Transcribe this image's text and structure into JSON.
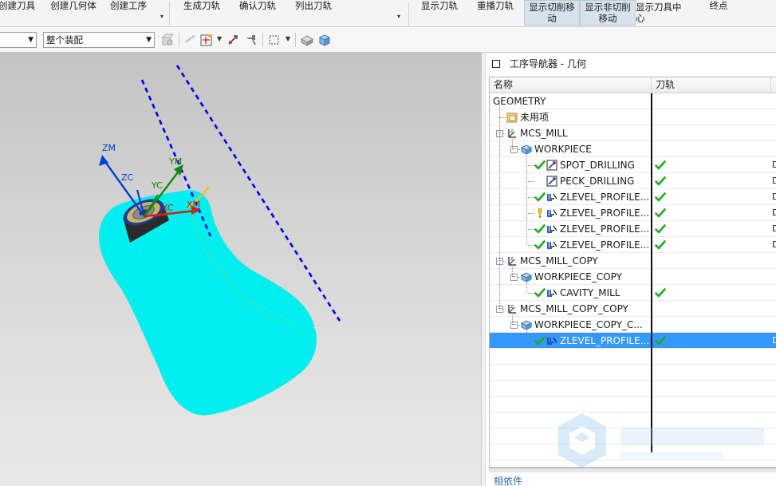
{
  "ribbon": {
    "buttons": [
      {
        "id": "create-tool",
        "label": "创建刀具"
      },
      {
        "id": "create-geometry",
        "label": "创建几何体"
      },
      {
        "id": "create-operation",
        "label": "创建工序"
      },
      {
        "id": "generate-path",
        "label": "生成刀轨"
      },
      {
        "id": "verify-path",
        "label": "确认刀轨"
      },
      {
        "id": "list-path",
        "label": "列出刀轨"
      },
      {
        "id": "show-path",
        "label": "显示刀轨"
      },
      {
        "id": "replay-path",
        "label": "重播刀轨"
      },
      {
        "id": "show-cut-moves",
        "label": "显示切削移动",
        "line1": "显示切削移",
        "line2": "动",
        "active": true
      },
      {
        "id": "show-noncut-moves",
        "label": "显示非切削移动",
        "line1": "显示非切削",
        "line2": "移动",
        "active": true
      },
      {
        "id": "show-tool-center",
        "label": "显示刀具中心",
        "line1": "显示刀具中",
        "line2": "心"
      },
      {
        "id": "end-point",
        "label": "终点"
      }
    ]
  },
  "toolbar": {
    "filter_combo": "",
    "assembly_combo": "整个装配"
  },
  "viewport": {
    "axes": {
      "zm": "ZM",
      "zc": "ZC",
      "ym": "YM",
      "yc": "YC",
      "xc": "XC",
      "xm": "XM"
    },
    "colors": {
      "part": "#00eeee",
      "toolpath": "#0000ee",
      "background": "#d0d0d0"
    }
  },
  "navigator": {
    "title": "工序导航器 - 几何",
    "columns": [
      "名称",
      "刀轨",
      ""
    ],
    "rows": [
      {
        "name": "GEOMETRY",
        "level": 0,
        "icon": "none",
        "path_ok": false,
        "extra": ""
      },
      {
        "name": "未用项",
        "level": 1,
        "icon": "unused-folder-icon",
        "path_ok": false,
        "extra": ""
      },
      {
        "name": "MCS_MILL",
        "level": 1,
        "icon": "mcs-icon",
        "path_ok": false,
        "extra": "",
        "expanded": true
      },
      {
        "name": "WORKPIECE",
        "level": 2,
        "icon": "workpiece-icon",
        "path_ok": false,
        "extra": "",
        "expanded": true
      },
      {
        "name": "SPOT_DRILLING",
        "level": 3,
        "icon": "drill-icon",
        "status": "ok",
        "path_ok": true,
        "extra": "D"
      },
      {
        "name": "PECK_DRILLING",
        "level": 3,
        "icon": "drill-icon",
        "status": "none",
        "path_ok": true,
        "extra": "D"
      },
      {
        "name": "ZLEVEL_PROFILE...",
        "level": 3,
        "icon": "zlevel-icon",
        "status": "ok",
        "path_ok": true,
        "extra": "D"
      },
      {
        "name": "ZLEVEL_PROFILE...",
        "level": 3,
        "icon": "zlevel-icon",
        "status": "warn",
        "path_ok": true,
        "extra": "D"
      },
      {
        "name": "ZLEVEL_PROFILE...",
        "level": 3,
        "icon": "zlevel-icon",
        "status": "ok",
        "path_ok": true,
        "extra": "D"
      },
      {
        "name": "ZLEVEL_PROFILE...",
        "level": 3,
        "icon": "zlevel-icon",
        "status": "ok",
        "path_ok": true,
        "extra": "D"
      },
      {
        "name": "MCS_MILL_COPY",
        "level": 1,
        "icon": "mcs-icon",
        "path_ok": false,
        "extra": "",
        "expanded": true
      },
      {
        "name": "WORKPIECE_COPY",
        "level": 2,
        "icon": "workpiece-icon",
        "path_ok": false,
        "extra": "",
        "expanded": true
      },
      {
        "name": "CAVITY_MILL",
        "level": 3,
        "icon": "zlevel-icon",
        "status": "ok",
        "path_ok": true,
        "extra": ""
      },
      {
        "name": "MCS_MILL_COPY_COPY",
        "level": 1,
        "icon": "mcs-icon",
        "path_ok": false,
        "extra": "",
        "expanded": true
      },
      {
        "name": "WORKPIECE_COPY_C...",
        "level": 2,
        "icon": "workpiece-icon",
        "path_ok": false,
        "extra": "",
        "expanded": true
      },
      {
        "name": "ZLEVEL_PROFILE...",
        "level": 3,
        "icon": "zlevel-icon",
        "status": "ok",
        "path_ok": true,
        "extra": "D",
        "selected": true
      }
    ],
    "dependency_label": "相依件"
  }
}
